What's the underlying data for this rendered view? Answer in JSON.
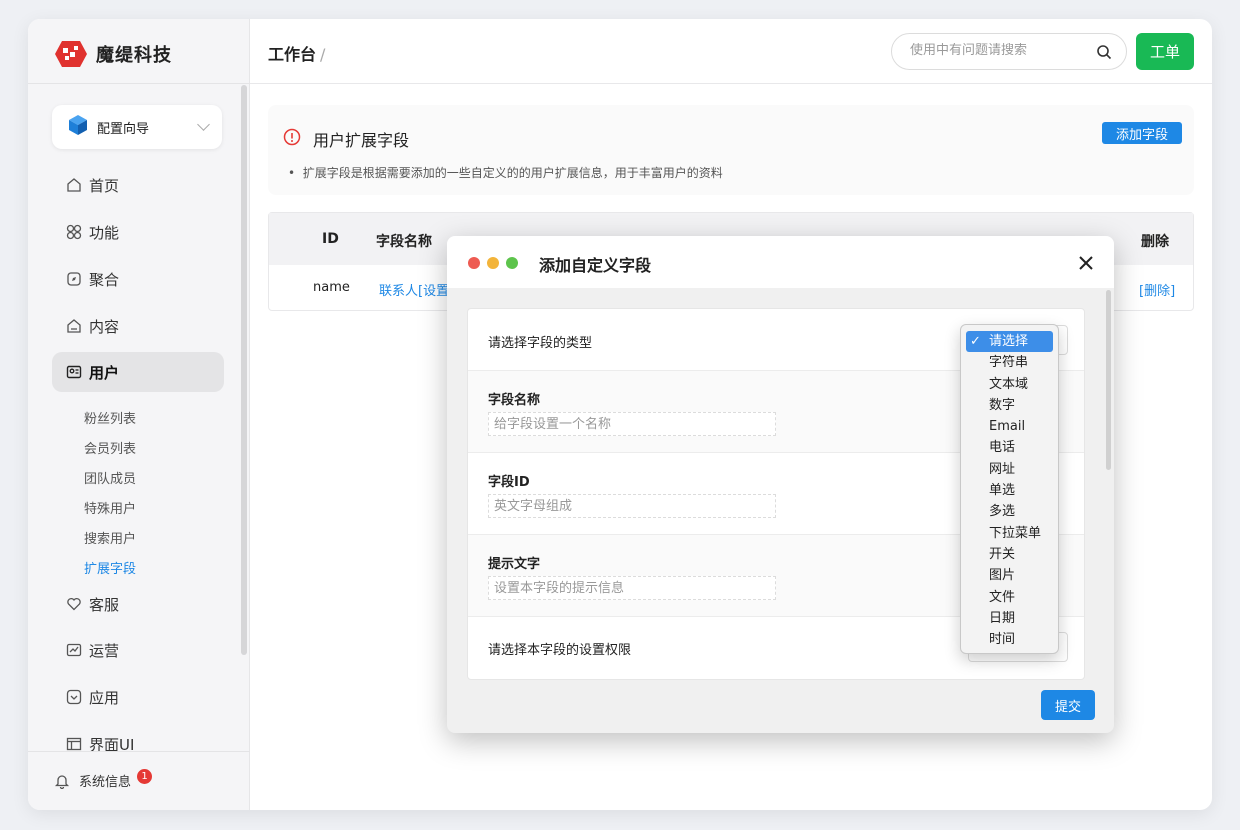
{
  "brand": {
    "name": "魔缇科技"
  },
  "sidebar": {
    "wizard_label": "配置向导",
    "items": [
      {
        "label": "首页",
        "icon": "home-icon"
      },
      {
        "label": "功能",
        "icon": "grid-icon"
      },
      {
        "label": "聚合",
        "icon": "compass-icon"
      },
      {
        "label": "内容",
        "icon": "content-icon"
      },
      {
        "label": "用户",
        "icon": "user-card-icon"
      },
      {
        "label": "客服",
        "icon": "heart-icon"
      },
      {
        "label": "运营",
        "icon": "chart-icon"
      },
      {
        "label": "应用",
        "icon": "app-icon"
      },
      {
        "label": "界面UI",
        "icon": "layout-icon"
      }
    ],
    "sub_items": [
      "粉丝列表",
      "会员列表",
      "团队成员",
      "特殊用户",
      "搜索用户",
      "扩展字段"
    ],
    "system_info": {
      "label": "系统信息",
      "badge": "1"
    }
  },
  "header": {
    "breadcrumb": "工作台",
    "separator": "/",
    "search_placeholder": "使用中有问题请搜索",
    "ticket_button": "工单"
  },
  "notice": {
    "title": "用户扩展字段",
    "description": "扩展字段是根据需要添加的一些自定义的的用户扩展信息，用于丰富用户的资料",
    "add_button": "添加字段"
  },
  "table": {
    "headers": {
      "id": "ID",
      "name": "字段名称",
      "delete": "删除"
    },
    "rows": [
      {
        "id": "name",
        "name": "联系人[设置",
        "delete": "[删除]"
      }
    ]
  },
  "modal": {
    "title": "添加自定义字段",
    "fields": {
      "type_label": "请选择字段的类型",
      "name_label": "字段名称",
      "name_placeholder": "给字段设置一个名称",
      "id_label": "字段ID",
      "id_placeholder": "英文字母组成",
      "hint_label": "提示文字",
      "hint_placeholder": "设置本字段的提示信息",
      "permission_label": "请选择本字段的设置权限"
    },
    "submit": "提交"
  },
  "dropdown": {
    "check": "✓",
    "options": [
      "请选择",
      "字符串",
      "文本域",
      "数字",
      "Email",
      "电话",
      "网址",
      "单选",
      "多选",
      "下拉菜单",
      "开关",
      "图片",
      "文件",
      "日期",
      "时间"
    ],
    "selected_index": 0
  },
  "colors": {
    "accent": "#1e88e5",
    "ticket_green": "#19b955",
    "badge_red": "#e53935"
  }
}
